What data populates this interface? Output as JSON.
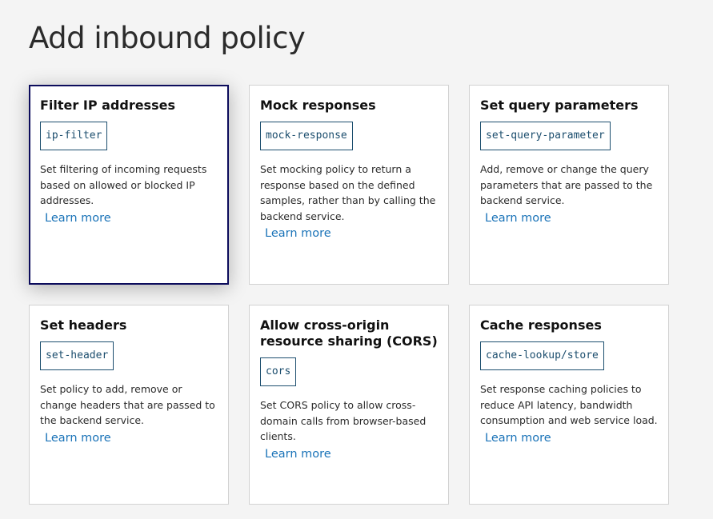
{
  "page": {
    "title": "Add inbound policy"
  },
  "cards": [
    {
      "title": "Filter IP addresses",
      "code": "ip-filter",
      "description": "Set filtering of incoming requests based on allowed or blocked IP addresses.",
      "link": "Learn more"
    },
    {
      "title": "Mock responses",
      "code": "mock-response",
      "description": "Set mocking policy to return a response based on the defined samples, rather than by calling the backend service.",
      "link": "Learn more"
    },
    {
      "title": "Set query parameters",
      "code": "set-query-parameter",
      "description": "Add, remove or change the query parameters that are passed to the backend service.",
      "link": "Learn more"
    },
    {
      "title": "Set headers",
      "code": "set-header",
      "description": "Set policy to add, remove or change headers that are passed to the backend service.",
      "link": "Learn more"
    },
    {
      "title": "Allow cross-origin resource sharing (CORS)",
      "code": "cors",
      "description": "Set CORS policy to allow cross-domain calls from browser-based clients.",
      "link": "Learn more"
    },
    {
      "title": "Cache responses",
      "code": "cache-lookup/store",
      "description": "Set response caching policies to reduce API latency, bandwidth consumption and web service load.",
      "link": "Learn more"
    }
  ],
  "colors": {
    "background": "#f4f4f4",
    "card_border": "#d2d2d2",
    "selected_border": "#0c0c5c",
    "code_border": "#1c4e6e",
    "link": "#1a73b8"
  }
}
